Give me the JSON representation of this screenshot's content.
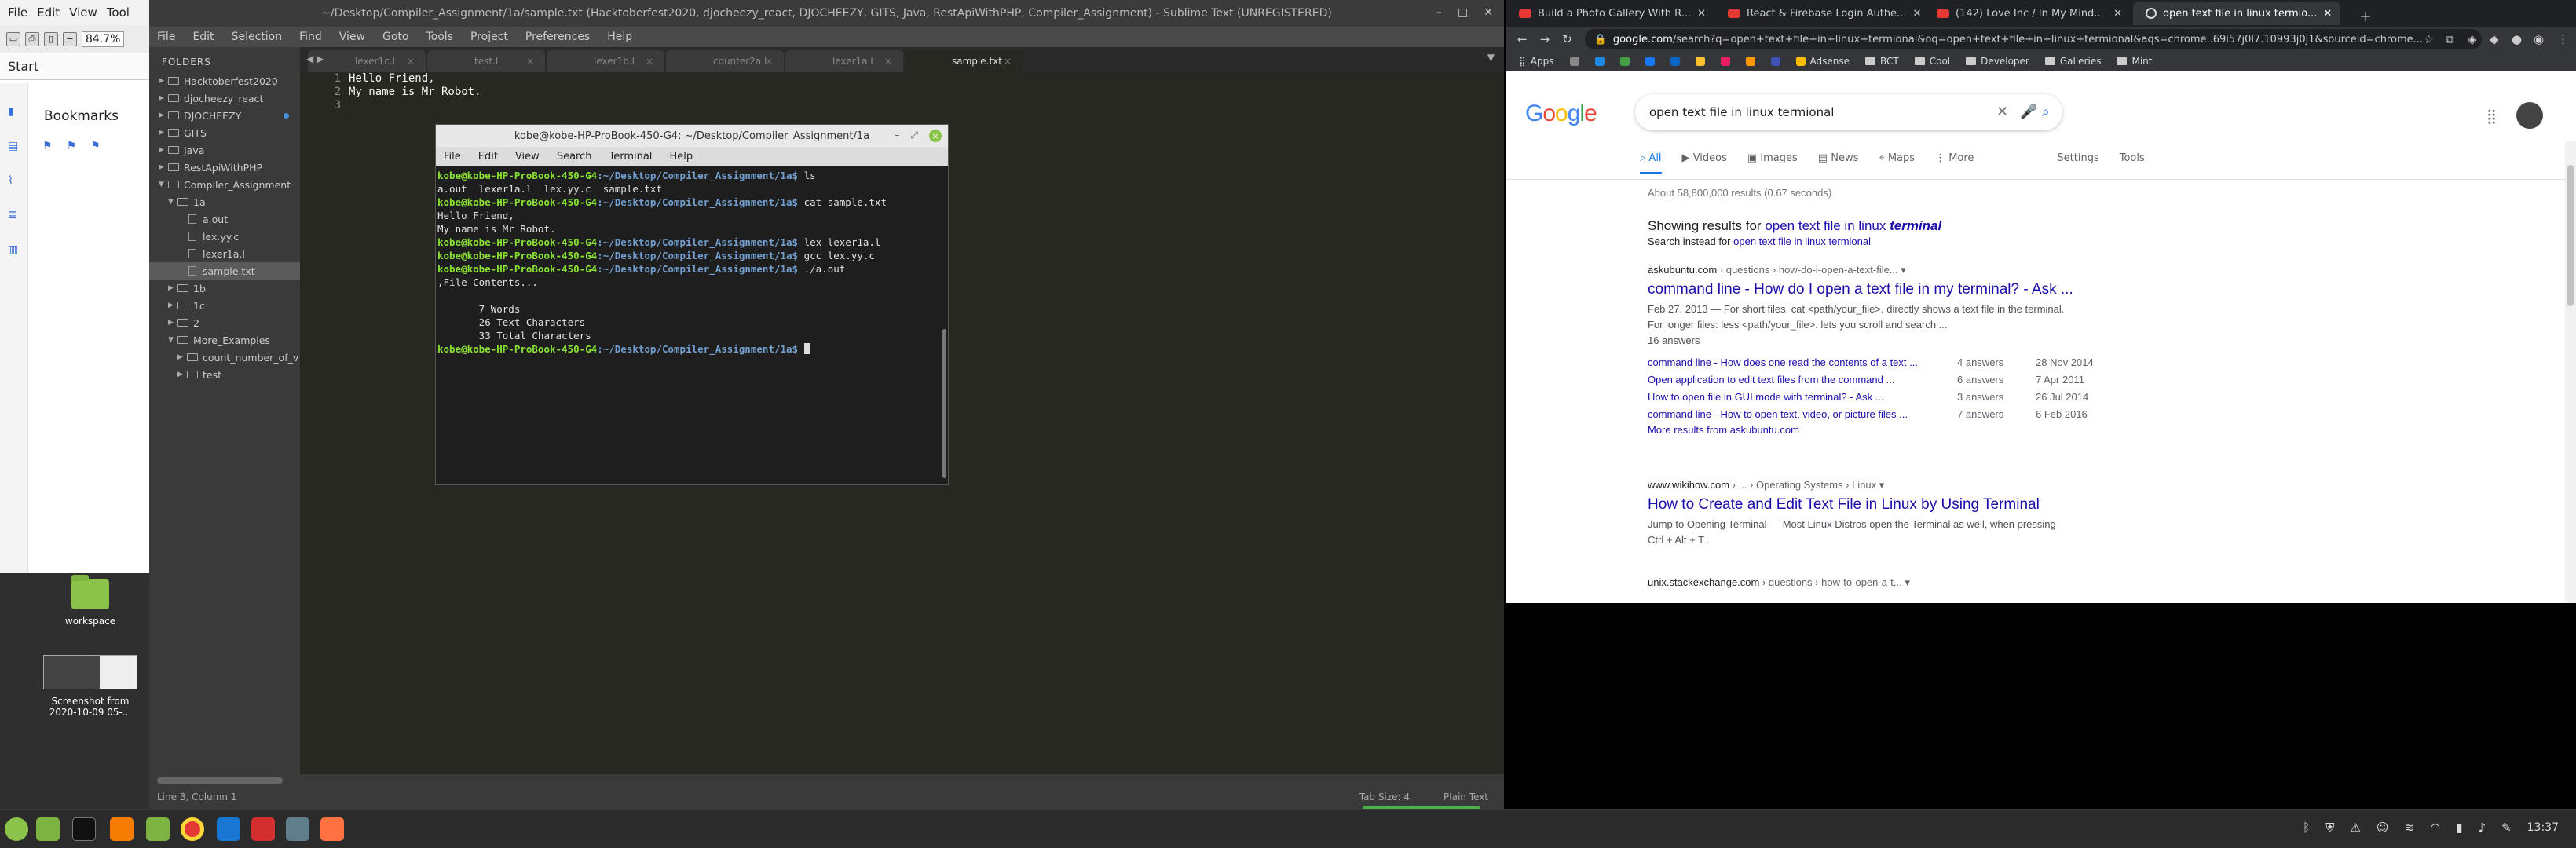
{
  "pdf_viewer": {
    "menu": [
      "File",
      "Edit",
      "View",
      "Tool"
    ],
    "zoom": "84.7%",
    "page_label": "Start",
    "bookmarks_title": "Bookmarks"
  },
  "desktop": {
    "icons": [
      {
        "label": "workspace"
      },
      {
        "label_line1": "Screenshot from",
        "label_line2": "2020-10-09 05-..."
      }
    ]
  },
  "sublime": {
    "title": "~/Desktop/Compiler_Assignment/1a/sample.txt (Hacktoberfest2020, djocheezy_react, DJOCHEEZY, GITS, Java, RestApiWithPHP, Compiler_Assignment) - Sublime Text (UNREGISTERED)",
    "menu": [
      "File",
      "Edit",
      "Selection",
      "Find",
      "View",
      "Goto",
      "Tools",
      "Project",
      "Preferences",
      "Help"
    ],
    "folders_header": "FOLDERS",
    "tree": [
      "Hacktoberfest2020",
      "djocheezy_react",
      "DJOCHEEZY",
      "GITS",
      "Java",
      "RestApiWithPHP",
      "Compiler_Assignment",
      "1a",
      "a.out",
      "lex.yy.c",
      "lexer1a.l",
      "sample.txt",
      "1b",
      "1c",
      "2",
      "More_Examples",
      "count_number_of_v",
      "test"
    ],
    "tabs": [
      "lexer1c.l",
      "test.l",
      "lexer1b.l",
      "counter2a.l",
      "lexer1a.l",
      "sample.txt"
    ],
    "line_numbers": [
      "1",
      "2",
      "3"
    ],
    "code_lines": [
      "Hello Friend,",
      "My name is Mr Robot.",
      ""
    ],
    "status_left": "Line 3, Column 1",
    "status_tabsize": "Tab Size: 4",
    "status_syntax": "Plain Text"
  },
  "terminal": {
    "title": "kobe@kobe-HP-ProBook-450-G4: ~/Desktop/Compiler_Assignment/1a",
    "menu": [
      "File",
      "Edit",
      "View",
      "Search",
      "Terminal",
      "Help"
    ],
    "prompt_user": "kobe@kobe-HP-ProBook-450-G4",
    "prompt_path": ":~/Desktop/Compiler_Assignment/1a$",
    "commands": [
      "ls",
      "cat sample.txt",
      "lex lexer1a.l",
      "gcc lex.yy.c",
      "./a.out",
      ""
    ],
    "outputs": {
      "ls": "a.out  lexer1a.l  lex.yy.c  sample.txt",
      "cat_1": "Hello Friend,",
      "cat_2": "My name is Mr Robot.",
      "run_1": ",File Contents...",
      "run_2": "",
      "run_3": "       7 Words",
      "run_4": "       26 Text Characters",
      "run_5": "       33 Total Characters"
    }
  },
  "chrome": {
    "tabs": [
      "Build a Photo Gallery With R...",
      "React & Firebase Login Authe...",
      "(142) Love Inc / In My Mind...",
      "open text file in linux termio..."
    ],
    "url_host": "google.com",
    "url_rest": "/search?q=open+text+file+in+linux+termional&oq=open+text+file+in+linux+termional&aqs=chrome..69i57j0l7.10993j0j1&sourceid=chrome...",
    "bookmarks": [
      "Apps",
      "Adsense",
      "BCT",
      "Cool",
      "Developer",
      "Galleries",
      "Mint"
    ],
    "search": {
      "logo": "Google",
      "query": "open text file in linux termional",
      "tabs": [
        "All",
        "Videos",
        "Images",
        "News",
        "Maps",
        "More"
      ],
      "tools": [
        "Settings",
        "Tools"
      ],
      "stats": "About 58,800,000 results (0.67 seconds)",
      "showing_prefix": "Showing results for",
      "showing_query": "open text file in linux",
      "showing_fixed": "terminal",
      "instead_prefix": "Search instead for",
      "instead_query": "open text file in linux termional"
    },
    "results": [
      {
        "site": "askubuntu.com",
        "path": " › questions › how-do-i-open-a-text-file...",
        "title": "command line - How do I open a text file in my terminal? - Ask ...",
        "snippet_1": "Feb 27, 2013 — For short files: cat <path/your_file>. directly shows a text file in the terminal.",
        "snippet_2": "For longer files: less <path/your_file>. lets you scroll and search ...",
        "answers": "16 answers",
        "subresults": [
          {
            "title": "command line - How does one read the contents of a text ...",
            "answers": "4 answers",
            "date": "28 Nov 2014"
          },
          {
            "title": "Open application to edit text files from the command ...",
            "answers": "6 answers",
            "date": "7 Apr 2011"
          },
          {
            "title": "How to open file in GUI mode with terminal? - Ask ...",
            "answers": "3 answers",
            "date": "26 Jul 2014"
          },
          {
            "title": "command line - How to open text, video, or picture files ...",
            "answers": "7 answers",
            "date": "6 Feb 2016"
          }
        ],
        "more": "More results from askubuntu.com"
      },
      {
        "site": "www.wikihow.com",
        "path": " › ... › Operating Systems › Linux",
        "title": "How to Create and Edit Text File in Linux by Using Terminal",
        "snippet_1": "Jump to Opening Terminal — Most Linux Distros open the Terminal as well, when pressing",
        "snippet_2": "Ctrl + Alt + T ."
      },
      {
        "site": "unix.stackexchange.com",
        "path": " › questions › how-to-open-a-t..."
      }
    ]
  },
  "panel": {
    "clock": "13:37"
  }
}
